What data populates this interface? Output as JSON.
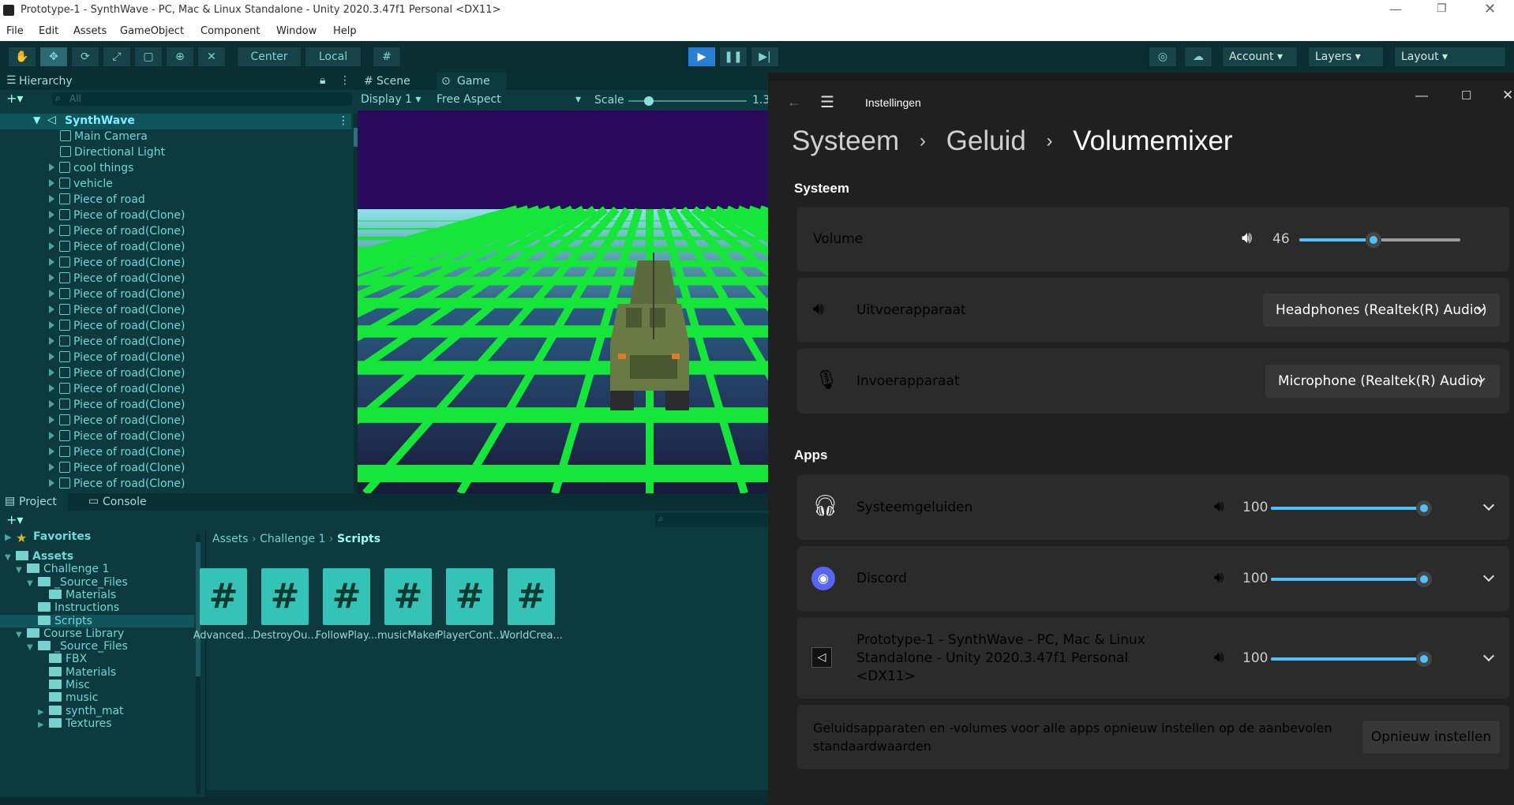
{
  "unity": {
    "window_title": "Prototype-1 - SynthWave - PC, Mac & Linux Standalone - Unity 2020.3.47f1 Personal <DX11>",
    "menu": [
      "File",
      "Edit",
      "Assets",
      "GameObject",
      "Component",
      "Window",
      "Help"
    ],
    "toolbar": {
      "center": "Center",
      "local": "Local",
      "account": "Account",
      "layers": "Layers",
      "layout": "Layout"
    },
    "hierarchy": {
      "tab": "Hierarchy",
      "search_placeholder": "All",
      "scene": "SynthWave",
      "items": [
        "Main Camera",
        "Directional Light",
        "cool things",
        "vehicle",
        "Piece of road",
        "Piece of road(Clone)",
        "Piece of road(Clone)",
        "Piece of road(Clone)",
        "Piece of road(Clone)",
        "Piece of road(Clone)",
        "Piece of road(Clone)",
        "Piece of road(Clone)",
        "Piece of road(Clone)",
        "Piece of road(Clone)",
        "Piece of road(Clone)",
        "Piece of road(Clone)",
        "Piece of road(Clone)",
        "Piece of road(Clone)",
        "Piece of road(Clone)",
        "Piece of road(Clone)",
        "Piece of road(Clone)",
        "Piece of road(Clone)",
        "Piece of road(Clone)"
      ]
    },
    "view_tabs": {
      "scene": "Scene",
      "game": "Game"
    },
    "game_bar": {
      "display": "Display 1",
      "aspect": "Free Aspect",
      "scale_label": "Scale",
      "scale_value": "1.3"
    },
    "project": {
      "tab": "Project",
      "console_tab": "Console",
      "favorites": "Favorites",
      "tree": [
        "Assets",
        "Challenge 1",
        "_Source_Files",
        "Materials",
        "Instructions",
        "Scripts",
        "Course Library",
        "_Source_Files",
        "FBX",
        "Materials",
        "Misc",
        "music",
        "synth_mat",
        "Textures"
      ],
      "breadcrumb": [
        "Assets",
        "Challenge 1",
        "Scripts"
      ],
      "scripts": [
        "Advanced...",
        "DestroyOu...",
        "FollowPlay...",
        "musicMaker",
        "PlayerCont...",
        "WorldCrea..."
      ]
    }
  },
  "settings": {
    "app_title": "Instellingen",
    "breadcrumb": [
      "Systeem",
      "Geluid",
      "Volumemixer"
    ],
    "system_header": "Systeem",
    "volume_label": "Volume",
    "volume_value": "46",
    "volume_level": 46,
    "output_label": "Uitvoerapparaat",
    "output_device": "Headphones (Realtek(R) Audio)",
    "input_label": "Invoerapparaat",
    "input_device": "Microphone (Realtek(R) Audio)",
    "apps_header": "Apps",
    "apps": [
      {
        "name": "Systeemgeluiden",
        "value": "100",
        "level": 100,
        "icon": "headphones-icon"
      },
      {
        "name": "Discord",
        "value": "100",
        "level": 100,
        "icon": "discord-icon"
      },
      {
        "name_lines": [
          "Prototype-1 - SynthWave - PC, Mac & Linux",
          "Standalone - Unity 2020.3.47f1 Personal",
          "<DX11>"
        ],
        "value": "100",
        "level": 100,
        "icon": "unity-icon"
      }
    ],
    "reset_text_lines": [
      "Geluidsapparaten en -volumes voor alle apps opnieuw instellen op de aanbevolen",
      "standaardwaarden"
    ],
    "reset_button": "Opnieuw instellen",
    "accent": "#4cc2ff"
  }
}
